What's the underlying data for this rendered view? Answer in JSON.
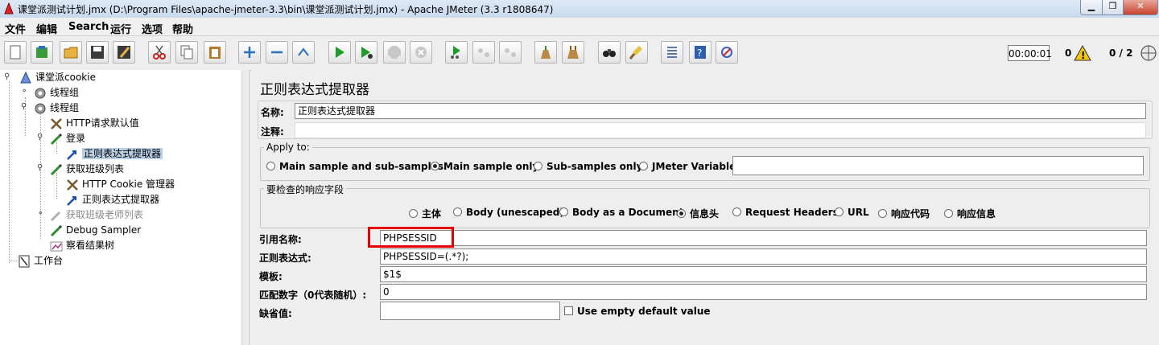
{
  "window": {
    "title": "课堂派测试计划.jmx (D:\\Program Files\\apache-jmeter-3.3\\bin\\课堂派测试计划.jmx) - Apache JMeter (3.3 r1808647)",
    "buttons": [
      "minimize",
      "maximize",
      "close"
    ]
  },
  "menu": [
    "文件",
    "编辑",
    "Search",
    "运行",
    "选项",
    "帮助"
  ],
  "toolbar": {
    "icons": [
      "new-icon",
      "templates-icon",
      "open-icon",
      "save-icon",
      "save-as-icon",
      "cut-icon",
      "copy-icon",
      "paste-icon",
      "expand-icon",
      "collapse-icon",
      "toggle-icon",
      "start-icon",
      "start-no-pause-icon",
      "stop-icon",
      "shutdown-icon",
      "remote-start-icon",
      "remote-stop-icon",
      "remote-exit-icon",
      "clear-icon",
      "clear-all-icon",
      "search-icon",
      "reset-search-icon",
      "function-helper-icon",
      "help-icon",
      "log-viewer-icon"
    ],
    "timer": "00:00:01",
    "error_count": "0",
    "threads": "0 / 2"
  },
  "tree": {
    "items": [
      {
        "label": "课堂派cookie",
        "icon": "test-plan-icon"
      },
      {
        "label": "线程组",
        "icon": "thread-group-icon"
      },
      {
        "label": "线程组",
        "icon": "thread-group-icon"
      },
      {
        "label": "HTTP请求默认值",
        "icon": "config-icon"
      },
      {
        "label": "登录",
        "icon": "sampler-icon"
      },
      {
        "label": "正则表达式提取器",
        "icon": "extractor-icon"
      },
      {
        "label": "获取班级列表",
        "icon": "sampler-icon"
      },
      {
        "label": "HTTP Cookie 管理器",
        "icon": "config-icon"
      },
      {
        "label": "正则表达式提取器",
        "icon": "extractor-icon"
      },
      {
        "label": "获取班级老师列表",
        "icon": "sampler-icon"
      },
      {
        "label": "Debug Sampler",
        "icon": "sampler-icon"
      },
      {
        "label": "察看结果树",
        "icon": "listener-icon"
      },
      {
        "label": "工作台",
        "icon": "workbench-icon"
      }
    ]
  },
  "panel": {
    "heading": "正则表达式提取器",
    "name_label": "名称:",
    "name_value": "正则表达式提取器",
    "comment_label": "注释:",
    "comment_value": "",
    "apply_to": {
      "legend": "Apply to:",
      "options": [
        "Main sample and sub-samples",
        "Main sample only",
        "Sub-samples only",
        "JMeter Variable"
      ],
      "selected": "Main sample only",
      "variable_value": ""
    },
    "field_to_check": {
      "legend": "要检查的响应字段",
      "options": [
        "主体",
        "Body (unescaped)",
        "Body as a Document",
        "信息头",
        "Request Headers",
        "URL",
        "响应代码",
        "响应信息"
      ],
      "selected": "信息头"
    },
    "ref_name_label": "引用名称:",
    "ref_name_value": "PHPSESSID",
    "regex_label": "正则表达式:",
    "regex_value": "PHPSESSID=(.*?);",
    "template_label": "模板:",
    "template_value": "$1$",
    "match_no_label": "匹配数字（0代表随机）:",
    "match_no_value": "0",
    "default_label": "缺省值:",
    "default_value": "",
    "use_empty_label": "Use empty default value"
  }
}
